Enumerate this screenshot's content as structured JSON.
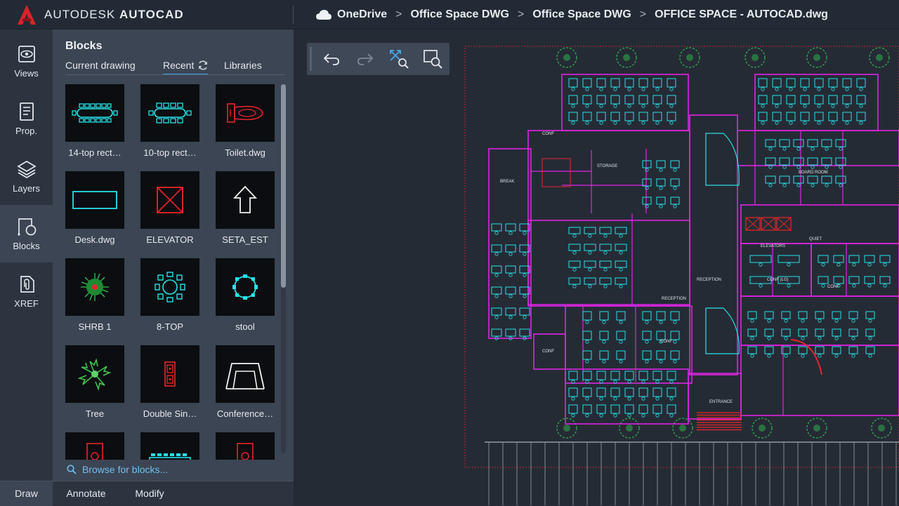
{
  "app": {
    "brand_light": "AUTODESK",
    "brand_bold": "AUTOCAD",
    "accent": "#d8232a"
  },
  "breadcrumb": {
    "icon": "cloud-icon",
    "items": [
      "OneDrive",
      "Office Space DWG",
      "Office Space DWG",
      "OFFICE SPACE - AUTOCAD.dwg"
    ],
    "separator": ">"
  },
  "rail": {
    "items": [
      {
        "label": "Views",
        "icon": "views-icon"
      },
      {
        "label": "Prop.",
        "icon": "properties-icon"
      },
      {
        "label": "Layers",
        "icon": "layers-icon"
      },
      {
        "label": "Blocks",
        "icon": "blocks-icon",
        "active": true
      },
      {
        "label": "XREF",
        "icon": "xref-icon"
      }
    ]
  },
  "panel": {
    "title": "Blocks",
    "tabs": [
      {
        "label": "Current drawing"
      },
      {
        "label": "Recent",
        "active": true
      },
      {
        "label": "Libraries"
      }
    ],
    "blocks": [
      {
        "label": "14-top rect…",
        "icon": "conference-table-14-icon"
      },
      {
        "label": "10-top rect…",
        "icon": "conference-table-10-icon"
      },
      {
        "label": "Toilet.dwg",
        "icon": "toilet-icon"
      },
      {
        "label": "Desk.dwg",
        "icon": "desk-icon"
      },
      {
        "label": "ELEVATOR",
        "icon": "elevator-icon"
      },
      {
        "label": "SETA_EST",
        "icon": "arrow-up-icon"
      },
      {
        "label": "SHRB 1",
        "icon": "shrub-icon"
      },
      {
        "label": "8-TOP",
        "icon": "round-table-icon"
      },
      {
        "label": "stool",
        "icon": "stool-icon"
      },
      {
        "label": "Tree",
        "icon": "tree-icon"
      },
      {
        "label": "Double Sin…",
        "icon": "double-sink-icon"
      },
      {
        "label": "Conference…",
        "icon": "conference-room-icon"
      }
    ],
    "browse_label": "Browse for blocks..."
  },
  "bottom_tabs": [
    {
      "label": "Draw",
      "active": true
    },
    {
      "label": "Annotate"
    },
    {
      "label": "Modify"
    }
  ],
  "drawing": {
    "room_labels": [
      "CONF",
      "BREAK",
      "STORAGE",
      "BOARD ROOM",
      "ELEVATORS",
      "QUIET",
      "RECEPTION",
      "RECEPTION",
      "CONF (LG)",
      "CONF",
      "CONF",
      "CONF",
      "ENTRANCE"
    ],
    "colors": {
      "walls": "#e023e6",
      "furniture": "#28e0e6",
      "red": "#e6262b",
      "green": "#2fa34a"
    }
  }
}
